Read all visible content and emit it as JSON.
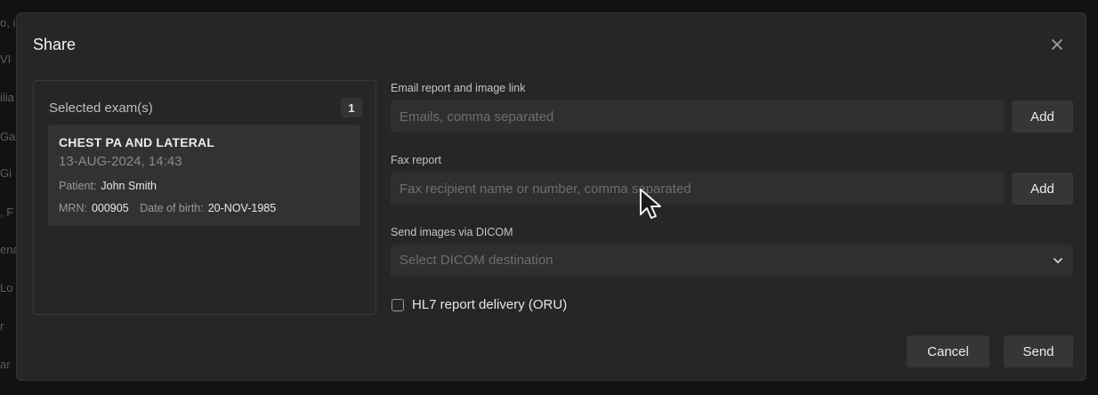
{
  "background_fragments": [
    "o, ii",
    "VI",
    "ilia",
    "Ga",
    "Gi",
    ", F",
    "ena",
    "Lo",
    "r",
    "ar"
  ],
  "dialog": {
    "title": "Share",
    "close_icon": "close-icon"
  },
  "selected_exams": {
    "label": "Selected exam(s)",
    "count": "1",
    "exam": {
      "title": "CHEST PA AND LATERAL",
      "datetime": "13-AUG-2024, 14:43",
      "patient_label": "Patient:",
      "patient_name": "John Smith",
      "mrn_label": "MRN:",
      "mrn": "000905",
      "dob_label": "Date of birth:",
      "dob": "20-NOV-1985"
    }
  },
  "email": {
    "label": "Email report and image link",
    "placeholder": "Emails, comma separated",
    "value": "",
    "add_label": "Add"
  },
  "fax": {
    "label": "Fax report",
    "placeholder": "Fax recipient name or number, comma separated",
    "value": "",
    "add_label": "Add"
  },
  "dicom": {
    "label": "Send images via DICOM",
    "placeholder": "Select DICOM destination",
    "chevron_icon": "chevron-down-icon"
  },
  "hl7": {
    "label": "HL7 report delivery (ORU)",
    "checked": false
  },
  "footer": {
    "cancel_label": "Cancel",
    "send_label": "Send"
  },
  "colors": {
    "dialog_bg": "#262626",
    "input_bg": "#2f2f2f",
    "button_bg": "#363636",
    "text_primary": "#ececec",
    "text_muted": "#6e6e6e"
  }
}
